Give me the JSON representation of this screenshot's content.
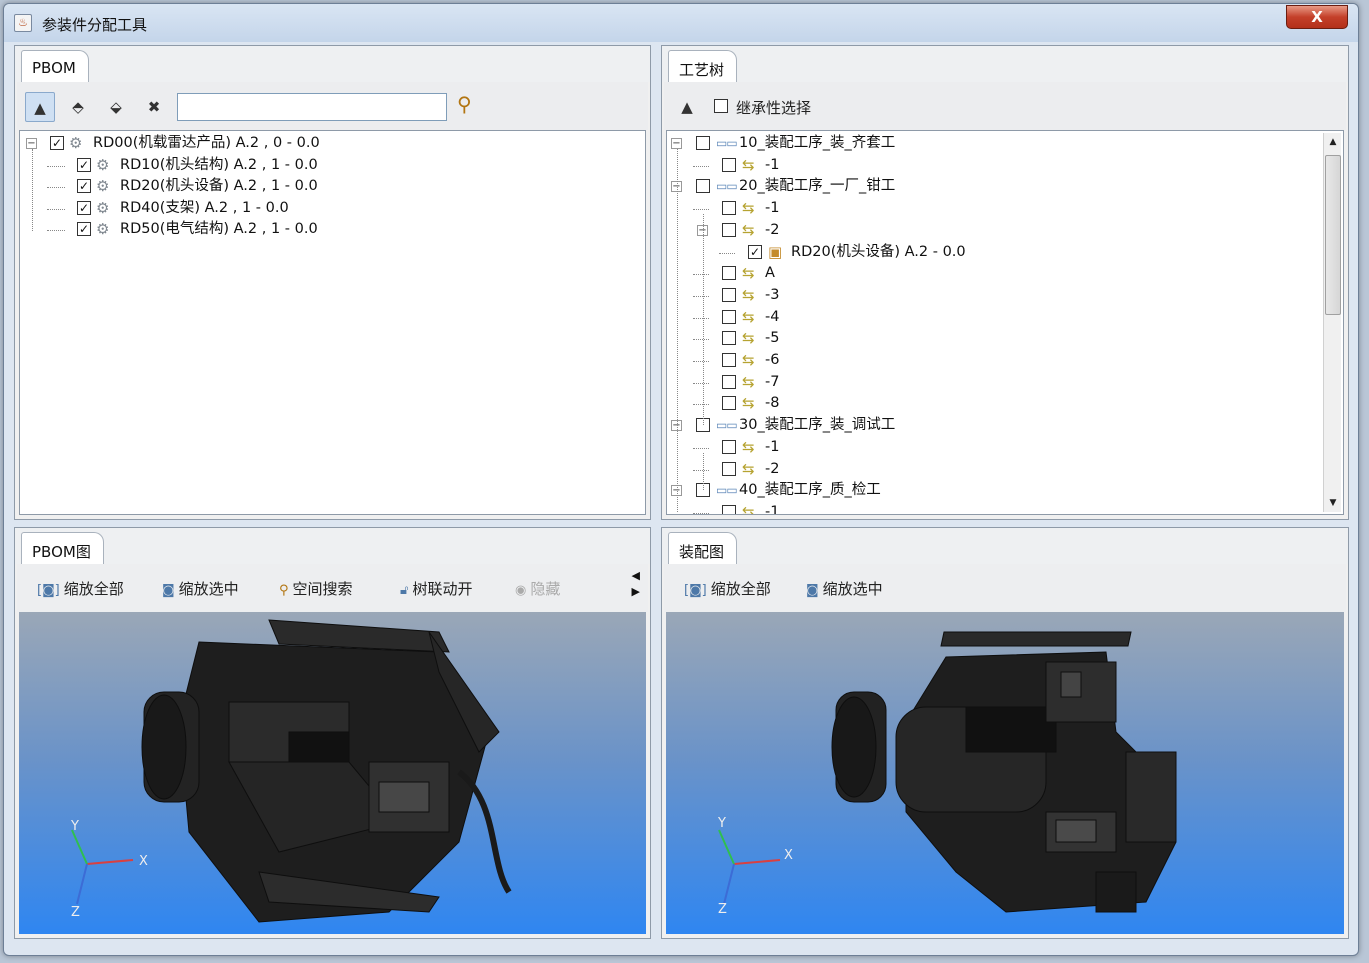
{
  "window": {
    "title": "参装件分配工具",
    "close_label": "X"
  },
  "pbom_panel": {
    "tab_label": "PBOM",
    "toolbar": {
      "buttons": [
        {
          "name": "tree-view-icon",
          "glyph": "▲▲"
        },
        {
          "name": "expand-icon",
          "glyph": "⬘"
        },
        {
          "name": "collapse-icon",
          "glyph": "⬙"
        },
        {
          "name": "clear-icon",
          "glyph": "✖"
        }
      ],
      "search_value": "",
      "search_icon": "magnifier-icon"
    },
    "tree": [
      {
        "label": "RD00(机载雷达产品) A.2 , 0 - 0.0",
        "checked": true,
        "level": 0,
        "expander": "−"
      },
      {
        "label": "RD10(机头结构) A.2 , 1 - 0.0",
        "checked": true,
        "level": 1
      },
      {
        "label": "RD20(机头设备) A.2 , 1 - 0.0",
        "checked": true,
        "level": 1
      },
      {
        "label": "RD40(支架) A.2 , 1 - 0.0",
        "checked": true,
        "level": 1
      },
      {
        "label": "RD50(电气结构) A.2 , 1 - 0.0",
        "checked": true,
        "level": 1
      }
    ]
  },
  "process_panel": {
    "tab_label": "工艺树",
    "inherit_label": "继承性选择",
    "inherit_checked": false,
    "tree": [
      {
        "label": "10_装配工序_装_齐套工",
        "type": "proc",
        "level": 0,
        "checked": false,
        "expander": "−"
      },
      {
        "label": "-1",
        "type": "op",
        "level": 1,
        "checked": false
      },
      {
        "label": "20_装配工序_一厂_钳工",
        "type": "proc",
        "level": 0,
        "checked": false,
        "expander": "−"
      },
      {
        "label": "-1",
        "type": "op",
        "level": 1,
        "checked": false
      },
      {
        "label": "-2",
        "type": "op",
        "level": 1,
        "checked": false,
        "expander": "−"
      },
      {
        "label": "RD20(机头设备) A.2 - 0.0",
        "type": "part",
        "level": 2,
        "checked": true
      },
      {
        "label": "A",
        "type": "op",
        "level": 1,
        "checked": false
      },
      {
        "label": "-3",
        "type": "op",
        "level": 1,
        "checked": false
      },
      {
        "label": "-4",
        "type": "op",
        "level": 1,
        "checked": false
      },
      {
        "label": "-5",
        "type": "op",
        "level": 1,
        "checked": false
      },
      {
        "label": "-6",
        "type": "op",
        "level": 1,
        "checked": false
      },
      {
        "label": "-7",
        "type": "op",
        "level": 1,
        "checked": false
      },
      {
        "label": "-8",
        "type": "op",
        "level": 1,
        "checked": false
      },
      {
        "label": "30_装配工序_装_调试工",
        "type": "proc",
        "level": 0,
        "checked": false,
        "expander": "−"
      },
      {
        "label": "-1",
        "type": "op",
        "level": 1,
        "checked": false
      },
      {
        "label": "-2",
        "type": "op",
        "level": 1,
        "checked": false
      },
      {
        "label": "40_装配工序_质_检工",
        "type": "proc",
        "level": 0,
        "checked": false,
        "expander": "−"
      },
      {
        "label": "-1",
        "type": "op",
        "level": 1,
        "checked": false
      }
    ]
  },
  "pbom_view": {
    "tab_label": "PBOM图",
    "buttons": {
      "zoom_all": "缩放全部",
      "zoom_selected": "缩放选中",
      "space_search": "空间搜索",
      "tree_link": "树联动开",
      "hide": "隐藏"
    },
    "axes": {
      "x": "X",
      "y": "Y",
      "z": "Z"
    }
  },
  "assembly_view": {
    "tab_label": "装配图",
    "buttons": {
      "zoom_all": "缩放全部",
      "zoom_selected": "缩放选中"
    },
    "axes": {
      "x": "X",
      "y": "Y",
      "z": "Z"
    }
  },
  "colors": {
    "viewport_top": "#9aa7b7",
    "viewport_bottom": "#2f86f1",
    "model": "#202020",
    "axis_x": "#d94040",
    "axis_y": "#2fbf4f",
    "axis_z": "#3c6cd6"
  }
}
